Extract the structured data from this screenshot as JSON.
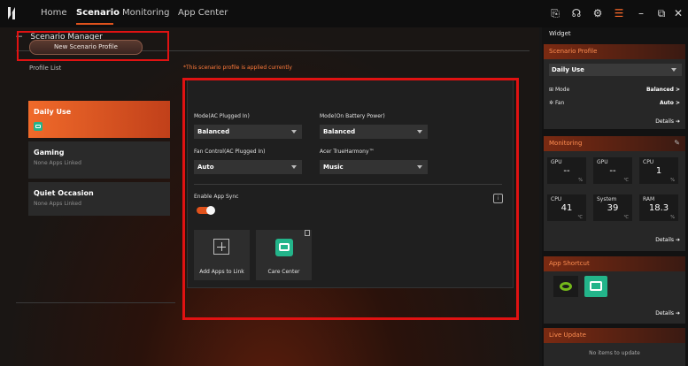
{
  "nav": {
    "tabs": [
      "Home",
      "Scenario",
      "Monitoring",
      "App Center"
    ],
    "active": "Scenario"
  },
  "titlebar_icons": [
    "overlay-icon",
    "headset-icon",
    "gear-icon",
    "menu-icon",
    "minimize-icon",
    "restore-icon",
    "close-icon"
  ],
  "header": {
    "back_label": "Scenario Manager"
  },
  "left": {
    "new_profile_label": "New Scenario Profile",
    "profile_list_label": "Profile List",
    "profiles": [
      {
        "name": "Daily Use",
        "sub": ""
      },
      {
        "name": "Gaming",
        "sub": "None Apps Linked"
      },
      {
        "name": "Quiet Occasion",
        "sub": "None Apps Linked"
      }
    ]
  },
  "panel": {
    "note": "*This scenario profile is applied currently",
    "mode_ac_label": "Mode(AC Plugged In)",
    "mode_ac_value": "Balanced",
    "mode_batt_label": "Mode(On Battery Power)",
    "mode_batt_value": "Balanced",
    "fan_label": "Fan Control(AC Plugged In)",
    "fan_value": "Auto",
    "harmony_label": "Acer TrueHarmony™",
    "harmony_value": "Music",
    "sync_label": "Enable App Sync",
    "sync_on": true,
    "tiles": [
      {
        "label": "Add Apps to Link"
      },
      {
        "label": "Care Center"
      }
    ]
  },
  "widget": {
    "title": "Widget",
    "scenario_title": "Scenario Profile",
    "selected": "Daily Use",
    "mode_label": "Mode",
    "mode_value": "Balanced >",
    "fan_label": "Fan",
    "fan_value": "Auto >",
    "details": "Details ➔",
    "monitoring_title": "Monitoring",
    "monitors": [
      {
        "label": "GPU",
        "value": "--",
        "unit": "%"
      },
      {
        "label": "GPU",
        "value": "--",
        "unit": "℃"
      },
      {
        "label": "CPU",
        "value": "1",
        "unit": "%"
      },
      {
        "label": "CPU",
        "value": "41",
        "unit": "℃"
      },
      {
        "label": "System",
        "value": "39",
        "unit": "℃"
      },
      {
        "label": "RAM",
        "value": "18.3",
        "unit": "%"
      }
    ],
    "shortcut_title": "App Shortcut",
    "live_title": "Live Update",
    "live_text": "No items to update"
  }
}
